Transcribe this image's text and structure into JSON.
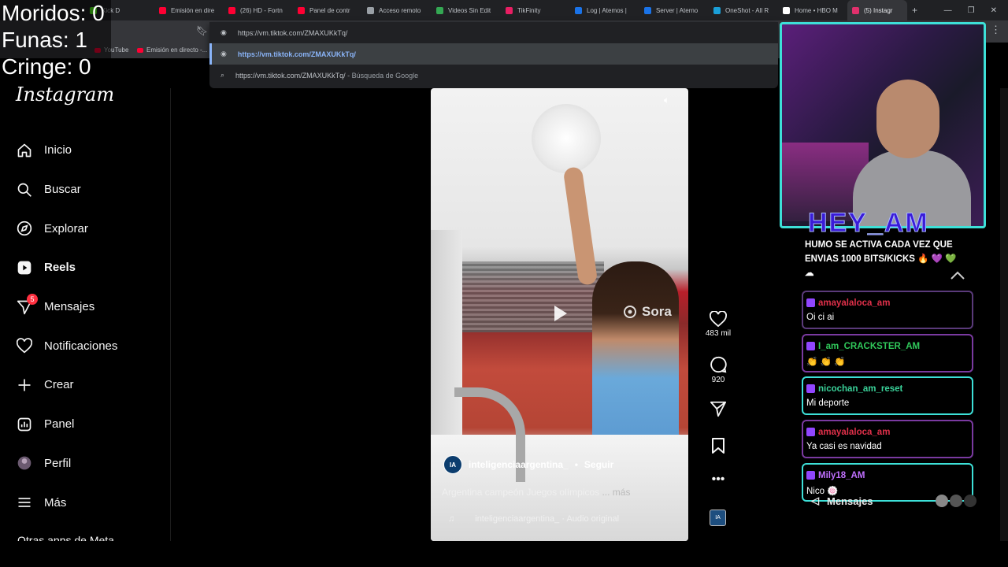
{
  "browser": {
    "tabs": [
      {
        "label": "Kick D",
        "color": "#53fc18"
      },
      {
        "label": "Emisión en dire",
        "color": "#ff0033"
      },
      {
        "label": "(26) HD - Fortn",
        "color": "#ff0033"
      },
      {
        "label": "Panel de contr",
        "color": "#ff0033"
      },
      {
        "label": "Acceso remoto",
        "color": "#9aa0a6"
      },
      {
        "label": "Videos Sin Edit",
        "color": "#34a853"
      },
      {
        "label": "TikFinity",
        "color": "#e91e63"
      },
      {
        "label": "Log | Atemos |",
        "color": "#1a73e8"
      },
      {
        "label": "Server | Aterno",
        "color": "#1a73e8"
      },
      {
        "label": "OneShot - All R",
        "color": "#1a9fd8"
      },
      {
        "label": "Home • HBO M",
        "color": "#ffffff"
      },
      {
        "label": "(5) Instagr",
        "color": "#e1306c"
      }
    ],
    "address": "https://vm.tiktok.com/ZMAXUKkTq/",
    "omnibox_suggestions": [
      {
        "text": "https://vm.tiktok.com/ZMAXUKkTq/",
        "suffix": ""
      },
      {
        "text": "https://vm.tiktok.com/ZMAXUKkTq/",
        "suffix": " - Búsqueda de Google"
      }
    ],
    "bookmarks": [
      {
        "label": "YouTube"
      },
      {
        "label": "Emisión en directo -..."
      }
    ]
  },
  "counters": {
    "moridos": "Moridos: 0",
    "funas": "Funas: 1",
    "cringe": "Cringe: 0"
  },
  "instagram": {
    "logo": "Instagram",
    "nav": [
      {
        "label": "Inicio",
        "icon": "home-icon"
      },
      {
        "label": "Buscar",
        "icon": "search-icon"
      },
      {
        "label": "Explorar",
        "icon": "compass-icon"
      },
      {
        "label": "Reels",
        "icon": "reels-icon",
        "active": true
      },
      {
        "label": "Mensajes",
        "icon": "messenger-icon",
        "badge": "5"
      },
      {
        "label": "Notificaciones",
        "icon": "heart-icon"
      },
      {
        "label": "Crear",
        "icon": "plus-icon"
      },
      {
        "label": "Panel",
        "icon": "dashboard-icon"
      },
      {
        "label": "Perfil",
        "icon": "avatar-icon"
      },
      {
        "label": "Más",
        "icon": "menu-icon"
      }
    ],
    "more_apps": "Otras apps de Meta"
  },
  "reel": {
    "author": "inteligenciaargentina_",
    "follow": "Seguir",
    "caption": "Argentina campeón Juegos olímpicos",
    "caption_more": "... más",
    "audio": "inteligenciaargentina_ · Audio original",
    "watermark": "Sora",
    "avatar_text": "IA",
    "likes": "483 mil",
    "comments": "920"
  },
  "stream_overlay": {
    "title": "HEY_AM",
    "pinned": "HUMO SE ACTIVA CADA VEZ QUE ENVIAS 1000 BITS/KICKS 🔥 💜 💚",
    "chat": [
      {
        "user": "amayalaloca_am",
        "color": "#e0304a",
        "border": "#5a3a7a",
        "text": "Oi ci ai"
      },
      {
        "user": "I_am_CRACKSTER_AM",
        "color": "#30c85a",
        "border": "#7a3aa0",
        "text": "👏 👏 👏"
      },
      {
        "user": "nicochan_am_reset",
        "color": "#3ad29a",
        "border": "#3de0d8",
        "text": "Mi deporte"
      },
      {
        "user": "amayalaloca_am",
        "color": "#e0304a",
        "border": "#7a3aa0",
        "text": "Ya casi es navidad"
      },
      {
        "user": "Mily18_AM",
        "color": "#c070ff",
        "border": "#3de0d8",
        "text": "Nico 🍥"
      }
    ],
    "messages_float": "Mensajes"
  }
}
